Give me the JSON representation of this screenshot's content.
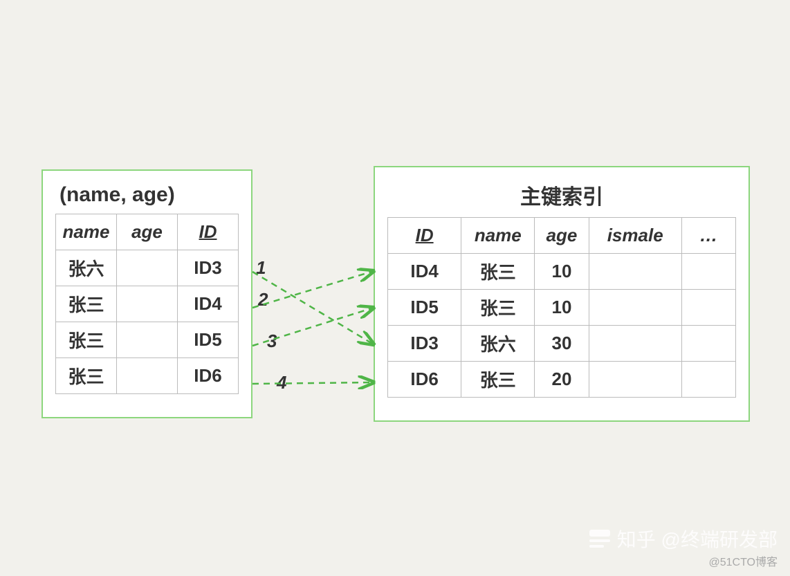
{
  "left": {
    "title": "(name, age)",
    "headers": [
      "name",
      "age",
      "ID"
    ],
    "rows": [
      {
        "name": "张六",
        "age": "",
        "id": "ID3"
      },
      {
        "name": "张三",
        "age": "",
        "id": "ID4"
      },
      {
        "name": "张三",
        "age": "",
        "id": "ID5"
      },
      {
        "name": "张三",
        "age": "",
        "id": "ID6"
      }
    ]
  },
  "right": {
    "title": "主键索引",
    "headers": [
      "ID",
      "name",
      "age",
      "ismale",
      "…"
    ],
    "rows": [
      {
        "id": "ID4",
        "name": "张三",
        "age": "10",
        "ismale": "",
        "more": ""
      },
      {
        "id": "ID5",
        "name": "张三",
        "age": "10",
        "ismale": "",
        "more": ""
      },
      {
        "id": "ID3",
        "name": "张六",
        "age": "30",
        "ismale": "",
        "more": ""
      },
      {
        "id": "ID6",
        "name": "张三",
        "age": "20",
        "ismale": "",
        "more": ""
      }
    ]
  },
  "arrows": {
    "labels": [
      "1",
      "2",
      "3",
      "4"
    ]
  },
  "watermark": {
    "main": "知乎 @终端研发部",
    "sub": "@51CTO博客"
  }
}
